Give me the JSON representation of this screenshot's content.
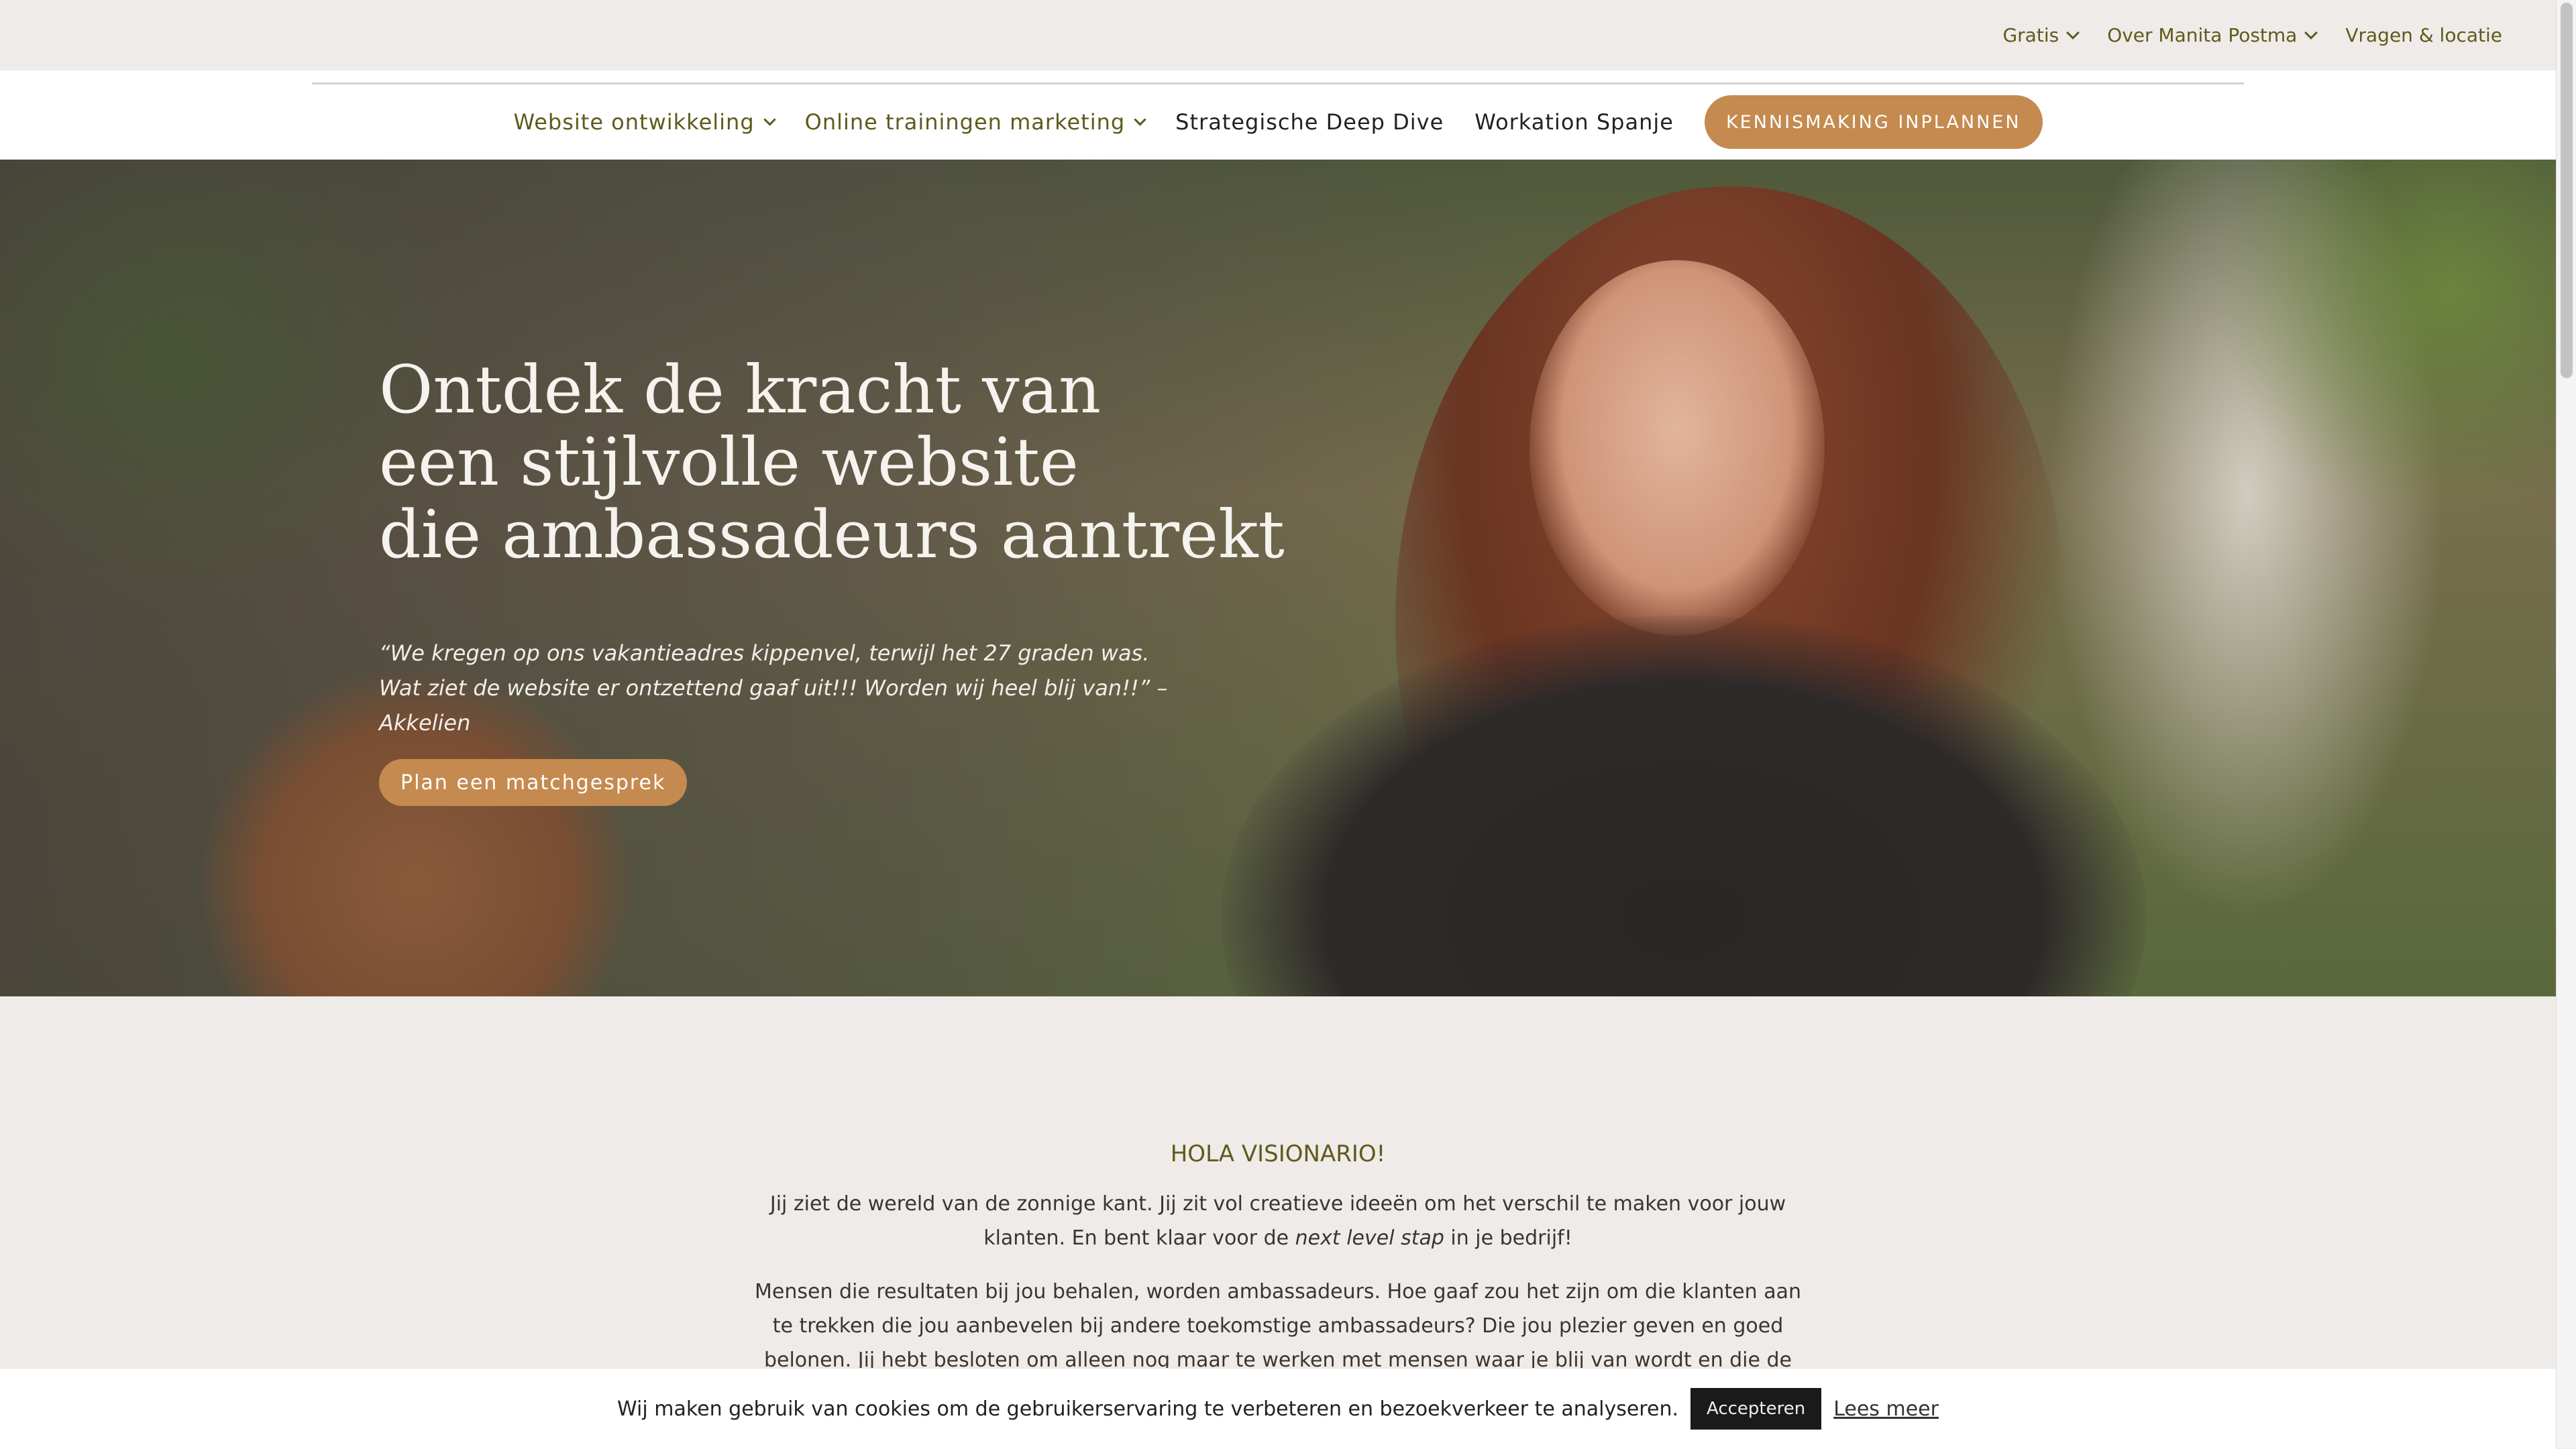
{
  "top_menu": [
    {
      "label": "Gratis",
      "dropdown": true,
      "icon": "chevron-down-icon"
    },
    {
      "label": "Over Manita Postma",
      "dropdown": true,
      "icon": "chevron-down-icon"
    },
    {
      "label": "Vragen & locatie",
      "dropdown": false
    }
  ],
  "main_nav": [
    {
      "label": "Website ontwikkeling",
      "dropdown": true
    },
    {
      "label": "Online trainingen marketing",
      "dropdown": true
    },
    {
      "label": "Strategische Deep Dive",
      "dropdown": false
    },
    {
      "label": "Workation Spanje",
      "dropdown": false
    }
  ],
  "cta_label": "KENNISMAKING INPLANNEN",
  "hero": {
    "title_lines": [
      "Ontdek de kracht van",
      "een stijlvolle website",
      "die ambassadeurs aantrekt"
    ],
    "quote": "“We kregen op ons vakantieadres kippenvel, terwijl het 27 graden was. Wat ziet de website er ontzettend gaaf uit!!! Worden wij heel blij van!!” – Akkelien",
    "button_label": "Plan een matchgesprek"
  },
  "intro": {
    "heading": "HOLA VISIONARIO!",
    "p1_a": "Jij ziet de wereld van de zonnige kant. Jij zit vol creatieve ideeën om het verschil te maken voor jouw klanten. En bent klaar voor de ",
    "p1_em": "next level stap",
    "p1_b": " in je bedrijf!",
    "p2": "Mensen die resultaten bij jou behalen, worden ambassadeurs. Hoe gaaf zou het zijn om die klanten aan te trekken die jou aanbevelen bij andere toekomstige ambassadeurs? Die jou plezier geven en goed belonen. Jij hebt besloten om alleen nog maar te werken met mensen waar je blij van wordt en die de resultaten behalen"
  },
  "cookie": {
    "text": "Wij maken gebruik van cookies om de gebruikerservaring te verbeteren en bezoekverkeer te analyseren.",
    "accept_label": "Accepteren",
    "more_label": "Lees meer"
  },
  "colors": {
    "olive": "#5f5a1c",
    "accent": "#c58a4f",
    "background": "#efebe8"
  }
}
